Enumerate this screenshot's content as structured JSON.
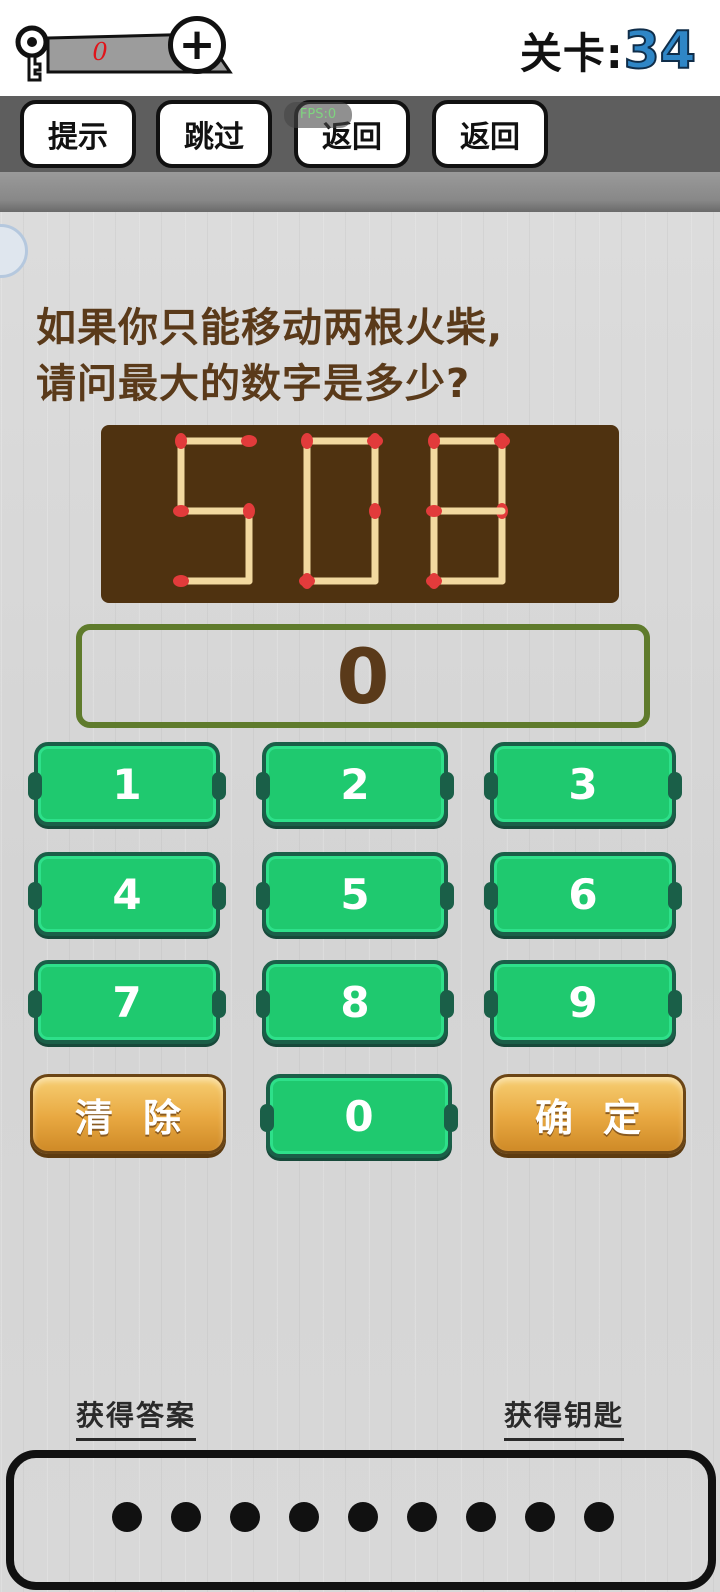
{
  "header": {
    "key_count": "0",
    "plus_symbol": "+",
    "level_label": "关卡:",
    "level_number": "34"
  },
  "toolbar": {
    "hint": "提示",
    "skip": "跳过",
    "back1": "返回",
    "back2": "返回",
    "fps": "FPS:0"
  },
  "question": {
    "line1": "如果你只能移动两根火柴,",
    "line2": "请问最大的数字是多少?"
  },
  "puzzle": {
    "digits": "508"
  },
  "answer": {
    "value": "0"
  },
  "keypad": {
    "keys": [
      "1",
      "2",
      "3",
      "4",
      "5",
      "6",
      "7",
      "8",
      "9"
    ],
    "clear": "清除",
    "zero": "0",
    "confirm": "确定"
  },
  "footer": {
    "get_answer": "获得答案",
    "get_key": "获得钥匙",
    "dot_count": 9
  },
  "colors": {
    "match_stick": "#f2d9a0",
    "match_head": "#e23b3b",
    "board": "#4f3210",
    "key_green": "#1fc96f",
    "level_blue": "#2f86c6"
  }
}
